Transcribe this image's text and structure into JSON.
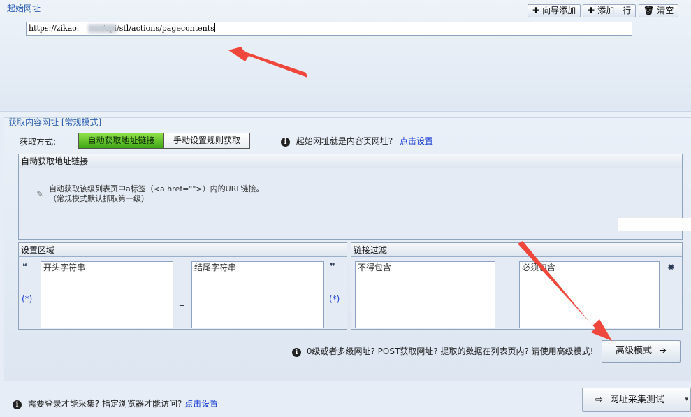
{
  "start_url": {
    "title": "起始网址",
    "value": "https://zikao.　　　/api/stl/actions/pagecontents",
    "toolbar": {
      "wizard_add": "向导添加",
      "add_row": "添加一行",
      "clear": "清空"
    }
  },
  "content_url": {
    "title": "获取内容网址 [常规模式]",
    "fetch_label": "获取方式:",
    "mode_auto": "自动获取地址链接",
    "mode_manual": "手动设置规则获取",
    "start_is_content_hint": "起始网址就是内容页网址?",
    "start_is_content_link": "点击设置",
    "auto_panel": {
      "title": "自动获取地址链接",
      "desc_line1": "自动获取该级列表页中a标签（<a href=\"\">）内的URL链接。",
      "desc_line2": "（常规模式默认抓取第一级）"
    },
    "settings_panel": {
      "title": "设置区域",
      "start_placeholder": "开头字符串",
      "end_placeholder": "结尾字符串",
      "open_quote": "❝",
      "close_quote": "❞",
      "regex_left": "(*)",
      "regex_right": "(*)",
      "separator": "_"
    },
    "filter_panel": {
      "title": "链接过滤",
      "exclude_placeholder": "不得包含",
      "include_placeholder": "必须包含"
    },
    "advanced_hint": "0级或者多级网址? POST获取网址? 提取的数据在列表页内? 请使用高级模式!",
    "advanced_button": "高级模式"
  },
  "footer": {
    "login_hint": "需要登录才能采集? 指定浏览器才能访问?",
    "login_link": "点击设置",
    "test_button": "网址采集测试"
  },
  "colors": {
    "accent_title": "#2a5db0",
    "active_green": "#3fa515",
    "annotation_arrow": "#f0473c"
  }
}
